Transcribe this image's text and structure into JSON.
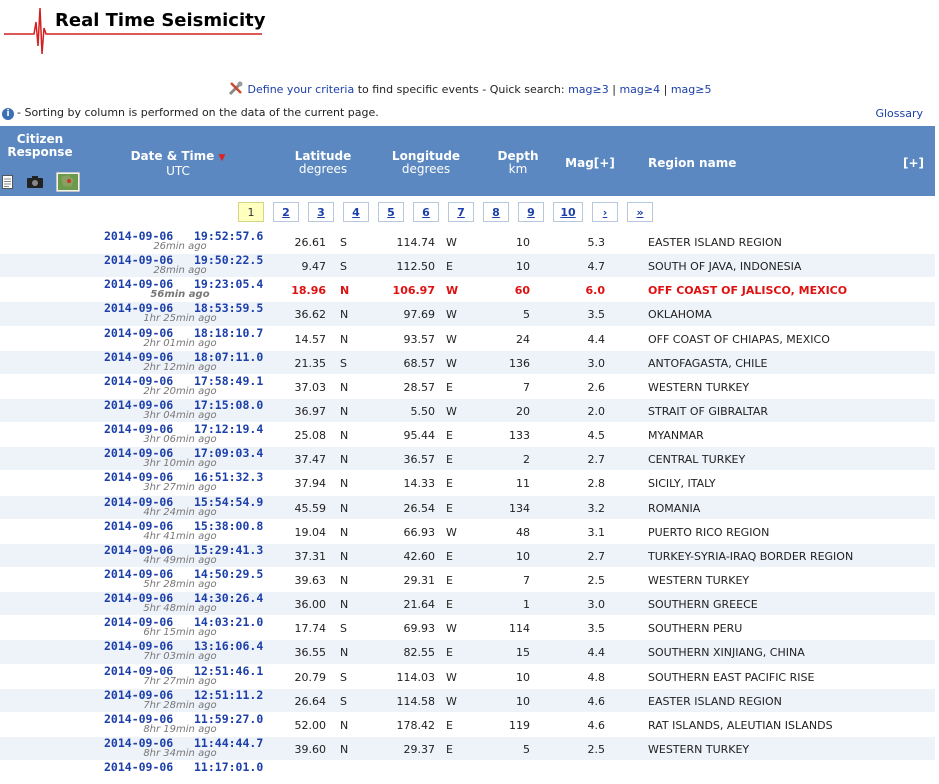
{
  "header": {
    "title": "Real Time Seismicity"
  },
  "criteria": {
    "define_link": "Define your criteria",
    "middle_text": "to find specific events - Quick search:",
    "quick": [
      "mag≥3",
      "mag≥4",
      "mag≥5"
    ],
    "sep": "|"
  },
  "note": "- Sorting by column is performed on the data of the current page.",
  "glossary": "Glossary",
  "columns": {
    "citizen": "Citizen Response",
    "date": "Date & Time",
    "date_sub": "UTC",
    "lat": "Latitude",
    "lat_sub": "degrees",
    "lon": "Longitude",
    "lon_sub": "degrees",
    "depth": "Depth",
    "depth_sub": "km",
    "mag": "Mag[+]",
    "region": "Region name",
    "expand": "[+]"
  },
  "pager": {
    "current": "1",
    "pages": [
      "2",
      "3",
      "4",
      "5",
      "6",
      "7",
      "8",
      "9",
      "10"
    ],
    "next": "›",
    "last": "»"
  },
  "rows": [
    {
      "dt": "2014-09-06   19:52:57.6",
      "ago": "26min ago",
      "lat": "26.61",
      "ns": "S",
      "lon": "114.74",
      "ew": "W",
      "depth": "10",
      "mag": "5.3",
      "region": "EASTER ISLAND REGION"
    },
    {
      "dt": "2014-09-06   19:50:22.5",
      "ago": "28min ago",
      "lat": "9.47",
      "ns": "S",
      "lon": "112.50",
      "ew": "E",
      "depth": "10",
      "mag": "4.7",
      "region": "SOUTH OF JAVA, INDONESIA"
    },
    {
      "dt": "2014-09-06   19:23:05.4",
      "ago": "56min ago",
      "lat": "18.96",
      "ns": "N",
      "lon": "106.97",
      "ew": "W",
      "depth": "60",
      "mag": "6.0",
      "region": "OFF COAST OF JALISCO, MEXICO",
      "highlight": true
    },
    {
      "dt": "2014-09-06   18:53:59.5",
      "ago": "1hr 25min ago",
      "lat": "36.62",
      "ns": "N",
      "lon": "97.69",
      "ew": "W",
      "depth": "5",
      "mag": "3.5",
      "region": "OKLAHOMA"
    },
    {
      "dt": "2014-09-06   18:18:10.7",
      "ago": "2hr 01min ago",
      "lat": "14.57",
      "ns": "N",
      "lon": "93.57",
      "ew": "W",
      "depth": "24",
      "mag": "4.4",
      "region": "OFF COAST OF CHIAPAS, MEXICO"
    },
    {
      "dt": "2014-09-06   18:07:11.0",
      "ago": "2hr 12min ago",
      "lat": "21.35",
      "ns": "S",
      "lon": "68.57",
      "ew": "W",
      "depth": "136",
      "mag": "3.0",
      "region": "ANTOFAGASTA, CHILE"
    },
    {
      "dt": "2014-09-06   17:58:49.1",
      "ago": "2hr 20min ago",
      "lat": "37.03",
      "ns": "N",
      "lon": "28.57",
      "ew": "E",
      "depth": "7",
      "mag": "2.6",
      "region": "WESTERN TURKEY"
    },
    {
      "dt": "2014-09-06   17:15:08.0",
      "ago": "3hr 04min ago",
      "lat": "36.97",
      "ns": "N",
      "lon": "5.50",
      "ew": "W",
      "depth": "20",
      "mag": "2.0",
      "region": "STRAIT OF GIBRALTAR"
    },
    {
      "dt": "2014-09-06   17:12:19.4",
      "ago": "3hr 06min ago",
      "lat": "25.08",
      "ns": "N",
      "lon": "95.44",
      "ew": "E",
      "depth": "133",
      "mag": "4.5",
      "region": "MYANMAR"
    },
    {
      "dt": "2014-09-06   17:09:03.4",
      "ago": "3hr 10min ago",
      "lat": "37.47",
      "ns": "N",
      "lon": "36.57",
      "ew": "E",
      "depth": "2",
      "mag": "2.7",
      "region": "CENTRAL TURKEY"
    },
    {
      "dt": "2014-09-06   16:51:32.3",
      "ago": "3hr 27min ago",
      "lat": "37.94",
      "ns": "N",
      "lon": "14.33",
      "ew": "E",
      "depth": "11",
      "mag": "2.8",
      "region": "SICILY, ITALY"
    },
    {
      "dt": "2014-09-06   15:54:54.9",
      "ago": "4hr 24min ago",
      "lat": "45.59",
      "ns": "N",
      "lon": "26.54",
      "ew": "E",
      "depth": "134",
      "mag": "3.2",
      "region": "ROMANIA"
    },
    {
      "dt": "2014-09-06   15:38:00.8",
      "ago": "4hr 41min ago",
      "lat": "19.04",
      "ns": "N",
      "lon": "66.93",
      "ew": "W",
      "depth": "48",
      "mag": "3.1",
      "region": "PUERTO RICO REGION"
    },
    {
      "dt": "2014-09-06   15:29:41.3",
      "ago": "4hr 49min ago",
      "lat": "37.31",
      "ns": "N",
      "lon": "42.60",
      "ew": "E",
      "depth": "10",
      "mag": "2.7",
      "region": "TURKEY-SYRIA-IRAQ BORDER REGION"
    },
    {
      "dt": "2014-09-06   14:50:29.5",
      "ago": "5hr 28min ago",
      "lat": "39.63",
      "ns": "N",
      "lon": "29.31",
      "ew": "E",
      "depth": "7",
      "mag": "2.5",
      "region": "WESTERN TURKEY"
    },
    {
      "dt": "2014-09-06   14:30:26.4",
      "ago": "5hr 48min ago",
      "lat": "36.00",
      "ns": "N",
      "lon": "21.64",
      "ew": "E",
      "depth": "1",
      "mag": "3.0",
      "region": "SOUTHERN GREECE"
    },
    {
      "dt": "2014-09-06   14:03:21.0",
      "ago": "6hr 15min ago",
      "lat": "17.74",
      "ns": "S",
      "lon": "69.93",
      "ew": "W",
      "depth": "114",
      "mag": "3.5",
      "region": "SOUTHERN PERU"
    },
    {
      "dt": "2014-09-06   13:16:06.4",
      "ago": "7hr 03min ago",
      "lat": "36.55",
      "ns": "N",
      "lon": "82.55",
      "ew": "E",
      "depth": "15",
      "mag": "4.4",
      "region": "SOUTHERN XINJIANG, CHINA"
    },
    {
      "dt": "2014-09-06   12:51:46.1",
      "ago": "7hr 27min ago",
      "lat": "20.79",
      "ns": "S",
      "lon": "114.03",
      "ew": "W",
      "depth": "10",
      "mag": "4.8",
      "region": "SOUTHERN EAST PACIFIC RISE"
    },
    {
      "dt": "2014-09-06   12:51:11.2",
      "ago": "7hr 28min ago",
      "lat": "26.64",
      "ns": "S",
      "lon": "114.58",
      "ew": "W",
      "depth": "10",
      "mag": "4.6",
      "region": "EASTER ISLAND REGION"
    },
    {
      "dt": "2014-09-06   11:59:27.0",
      "ago": "8hr 19min ago",
      "lat": "52.00",
      "ns": "N",
      "lon": "178.42",
      "ew": "E",
      "depth": "119",
      "mag": "4.6",
      "region": "RAT ISLANDS, ALEUTIAN ISLANDS"
    },
    {
      "dt": "2014-09-06   11:44:44.7",
      "ago": "8hr 34min ago",
      "lat": "39.60",
      "ns": "N",
      "lon": "29.37",
      "ew": "E",
      "depth": "5",
      "mag": "2.5",
      "region": "WESTERN TURKEY"
    },
    {
      "dt": "2014-09-06   11:17:01.0",
      "ago": "",
      "lat": "",
      "ns": "",
      "lon": "",
      "ew": "",
      "depth": "",
      "mag": "",
      "region": ""
    }
  ]
}
